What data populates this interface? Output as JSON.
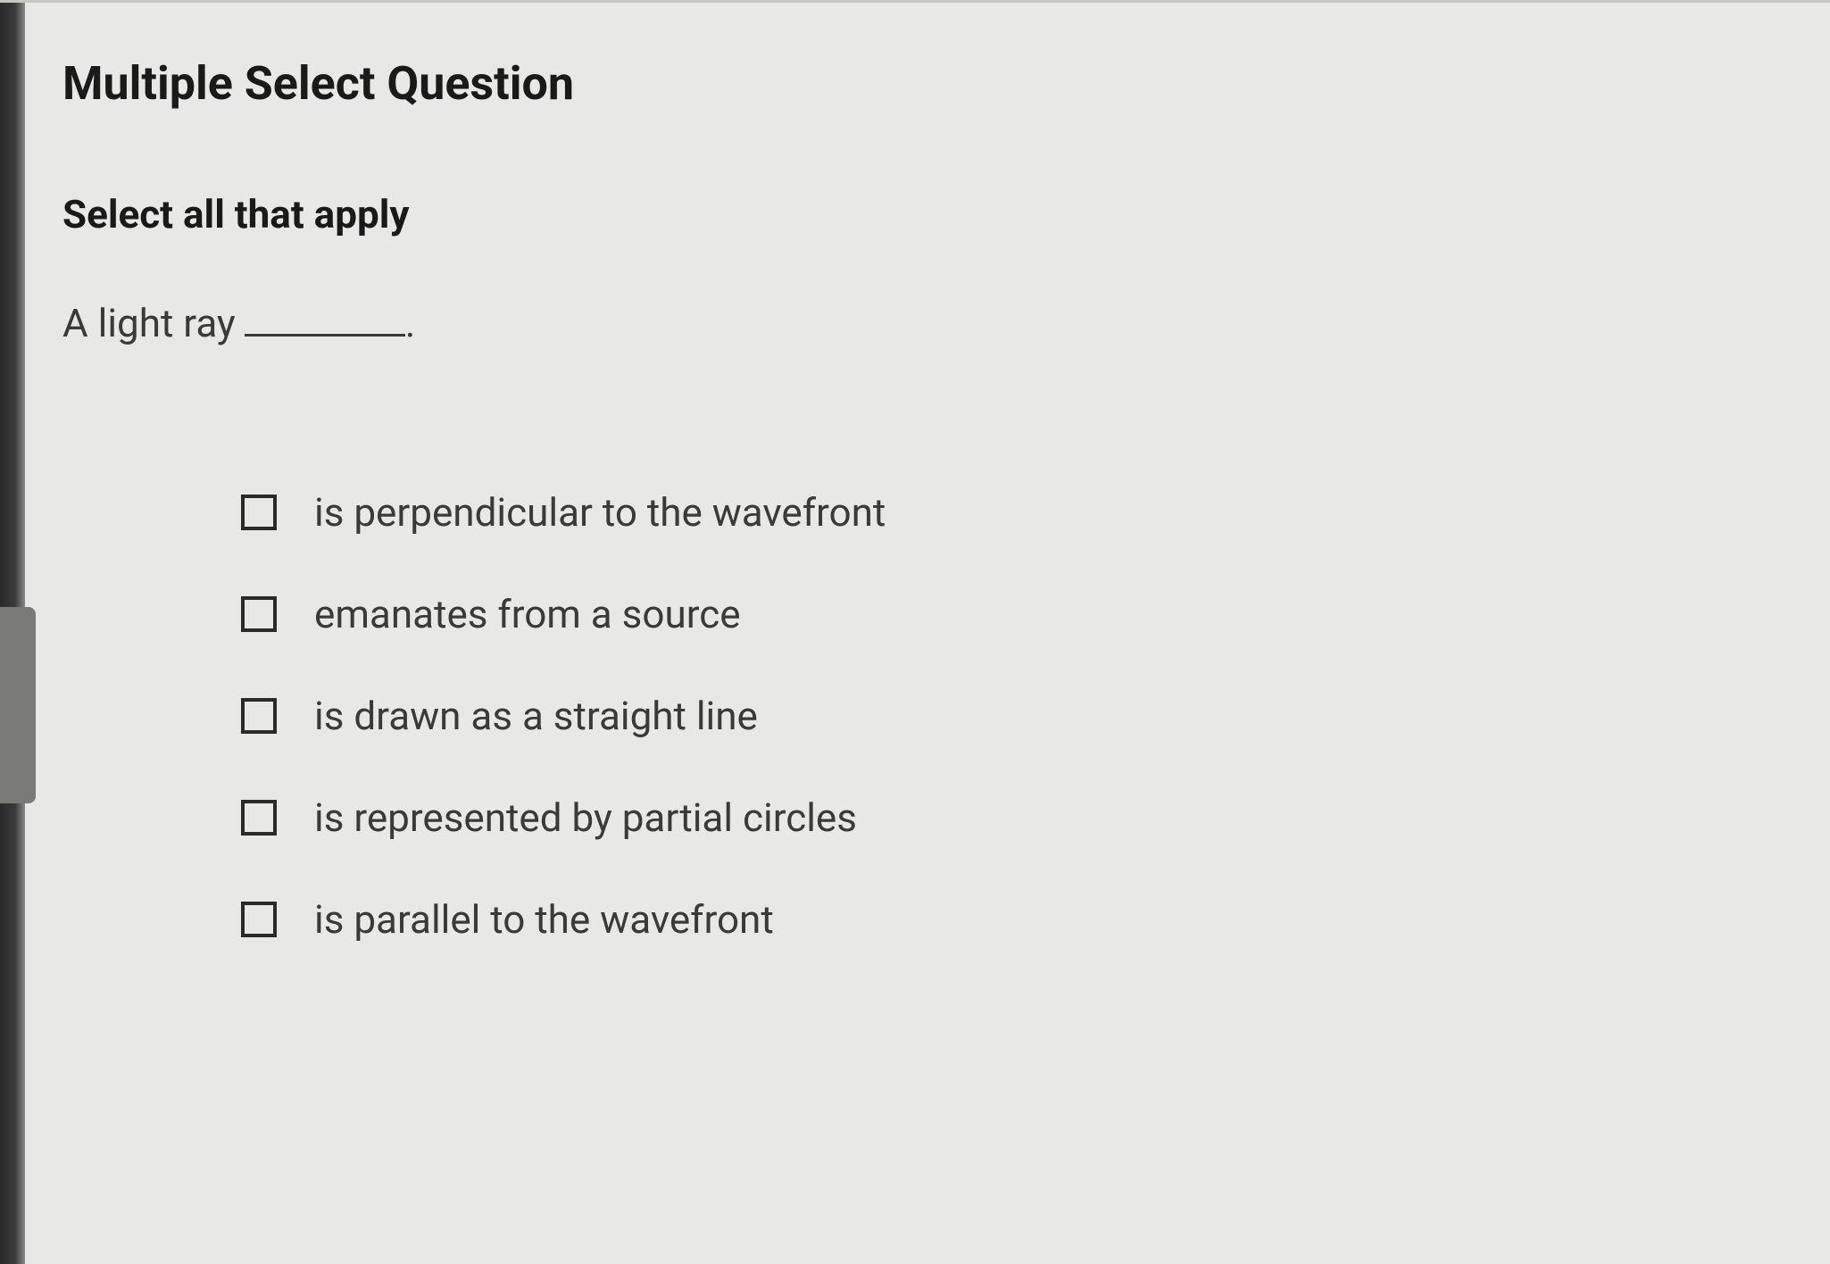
{
  "question": {
    "type_label": "Multiple Select Question",
    "instruction": "Select all that apply",
    "stem_prefix": "A light ray",
    "stem_suffix": ".",
    "options": [
      {
        "label": "is perpendicular to the wavefront"
      },
      {
        "label": "emanates from a source"
      },
      {
        "label": "is drawn as a straight line"
      },
      {
        "label": "is represented by partial circles"
      },
      {
        "label": "is parallel to the wavefront"
      }
    ]
  }
}
